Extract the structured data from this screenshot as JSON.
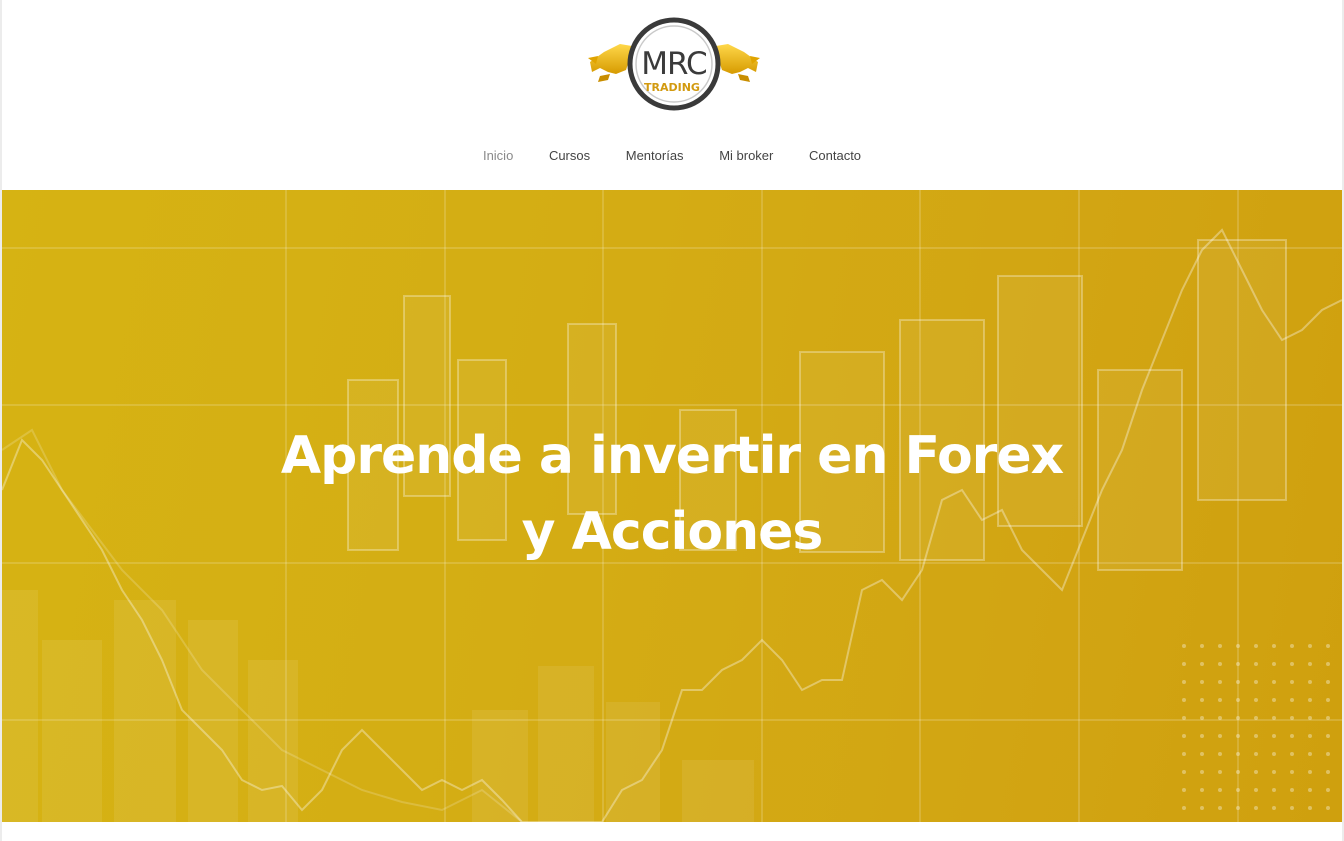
{
  "logo": {
    "main_text": "MRC",
    "sub_text": "TRADING"
  },
  "nav": {
    "items": [
      {
        "label": "Inicio",
        "active": true
      },
      {
        "label": "Cursos",
        "active": false
      },
      {
        "label": "Mentorías",
        "active": false
      },
      {
        "label": "Mi broker",
        "active": false
      },
      {
        "label": "Contacto",
        "active": false
      }
    ]
  },
  "hero": {
    "title_line1": "Aprende a invertir en Forex",
    "title_line2": "y Acciones",
    "background_color": "#d4ad14",
    "title_color": "#ffffff"
  },
  "colors": {
    "accent_gold": "#d4ad14",
    "nav_text": "#444444",
    "nav_active": "#8a8a8a"
  }
}
